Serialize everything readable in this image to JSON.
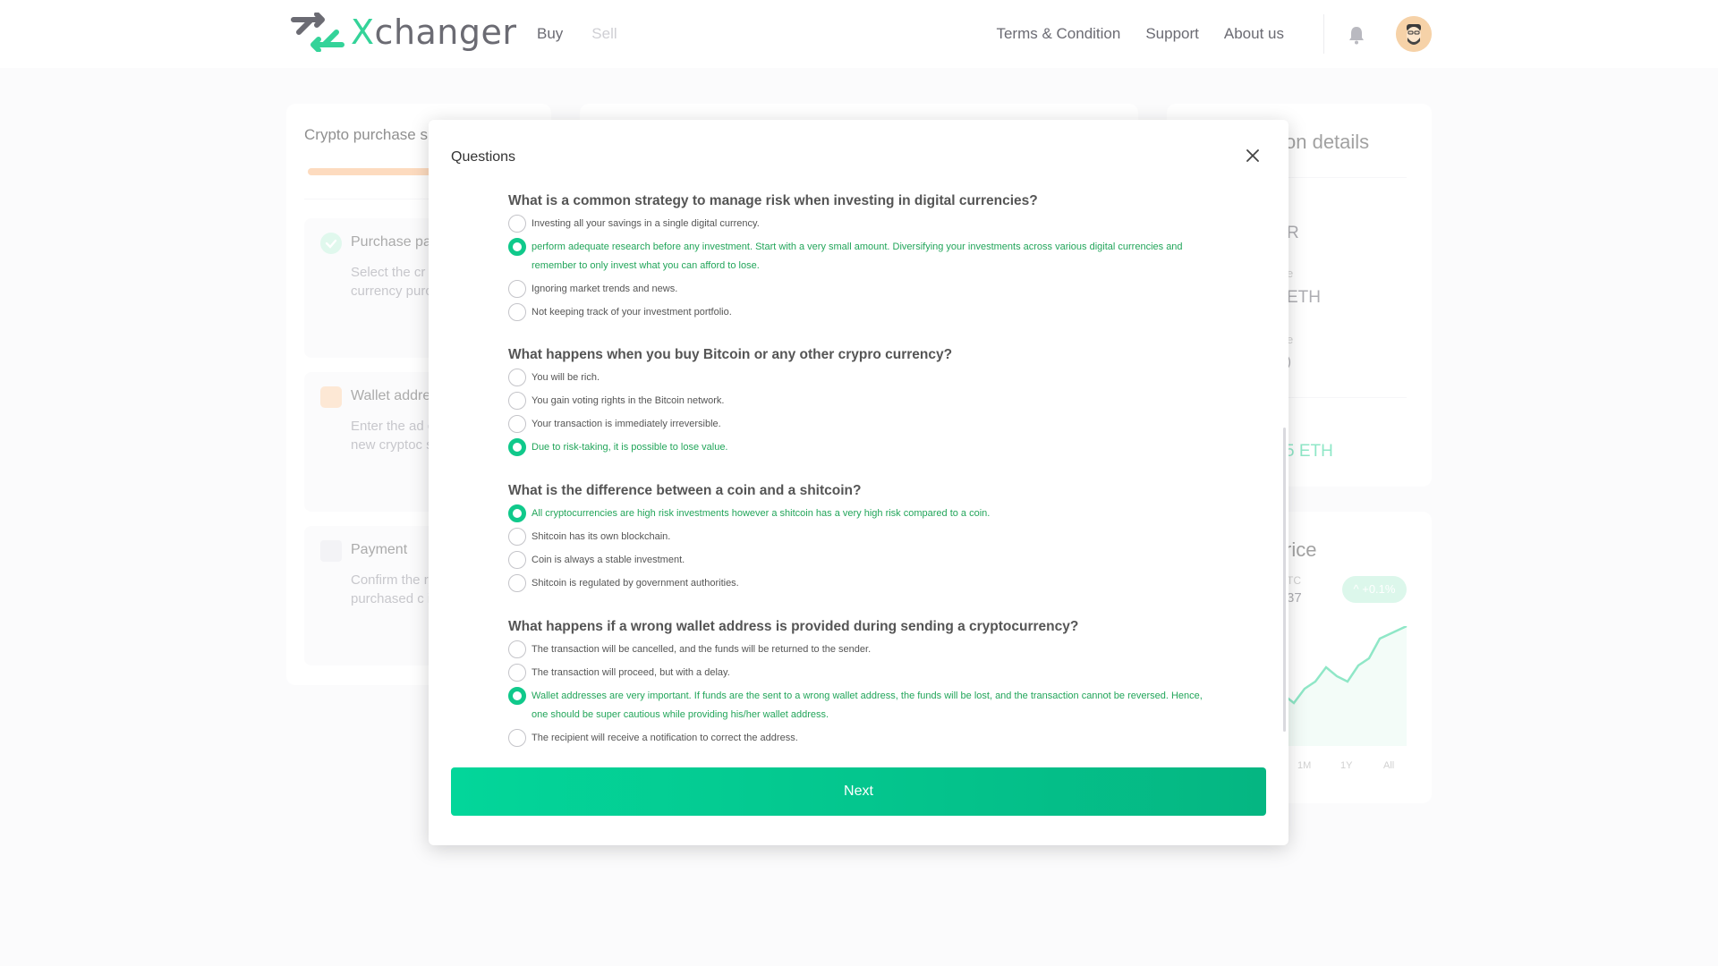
{
  "header": {
    "logo_text": "Xchanger",
    "nav_left": [
      "Buy",
      "Sell"
    ],
    "nav_right": [
      "Terms & Condition",
      "Support",
      "About us"
    ],
    "icons": [
      "bell-icon",
      "user-avatar"
    ]
  },
  "background": {
    "left_card_title": "Crypto purchase s",
    "steps": [
      {
        "title": "Purchase pa",
        "text": "Select the cr would like to fiat currency purchase cry",
        "icon": "check-circle-icon"
      },
      {
        "title": "Wallet addre",
        "text": "Enter the ad crypto wallet new cryptoc sent.",
        "icon": "wallet-icon"
      },
      {
        "title": "Payment",
        "text": "Confirm the receive your purchased c in a few min",
        "icon": "cart-icon"
      }
    ],
    "right_card_title": "on details",
    "right_values": [
      "R",
      "e",
      "ETH",
      "e",
      ")"
    ],
    "right_green": "5 ETH",
    "price_card_title": "rice",
    "price_label": "TC",
    "price_value": "37",
    "change_pill": "+0.1%",
    "ranges": [
      "1M",
      "1Y",
      "All"
    ]
  },
  "modal": {
    "title": "Questions",
    "questions": [
      {
        "question": "What is a common strategy to manage risk when investing in digital currencies?",
        "options": [
          {
            "text": "Investing all your savings in a single digital currency.",
            "checked": false
          },
          {
            "text": "perform adequate research before any investment. Start with a very small amount. Diversifying your investments across various digital currencies and remember to only invest what you can afford to lose.",
            "checked": true
          },
          {
            "text": "Ignoring market trends and news.",
            "checked": false
          },
          {
            "text": "Not keeping track of your investment portfolio.",
            "checked": false
          }
        ]
      },
      {
        "question": "What happens when you buy Bitcoin or any other crypro currency?",
        "options": [
          {
            "text": "You will be rich.",
            "checked": false
          },
          {
            "text": "You gain voting rights in the Bitcoin network.",
            "checked": false
          },
          {
            "text": "Your transaction is immediately irreversible.",
            "checked": false
          },
          {
            "text": "Due to risk-taking, it is possible to lose value.",
            "checked": true
          }
        ]
      },
      {
        "question": "What is the difference between a coin and a shitcoin?",
        "options": [
          {
            "text": "All cryptocurrencies are high risk investments however a shitcoin has a very high risk compared to a coin.",
            "checked": true
          },
          {
            "text": "Shitcoin has its own blockchain.",
            "checked": false
          },
          {
            "text": "Coin is always a stable investment.",
            "checked": false
          },
          {
            "text": "Shitcoin is regulated by government authorities.",
            "checked": false
          }
        ]
      },
      {
        "question": "What happens if a wrong wallet address is provided during sending a cryptocurrency?",
        "options": [
          {
            "text": "The transaction will be cancelled, and the funds will be returned to the sender.",
            "checked": false
          },
          {
            "text": "The transaction will proceed, but with a delay.",
            "checked": false
          },
          {
            "text": "Wallet addresses are very important. If funds are the sent to a wrong wallet address, the funds will be lost, and the transaction cannot be reversed. Hence, one should be super cautious while providing his/her wallet address.",
            "checked": true
          },
          {
            "text": "The recipient will receive a notification to correct the address.",
            "checked": false
          }
        ]
      }
    ],
    "next_label": "Next"
  },
  "colors": {
    "accent": "#10c98b",
    "checked_text": "#22a55a",
    "button_start": "#03d69a",
    "button_end": "#05b682"
  }
}
